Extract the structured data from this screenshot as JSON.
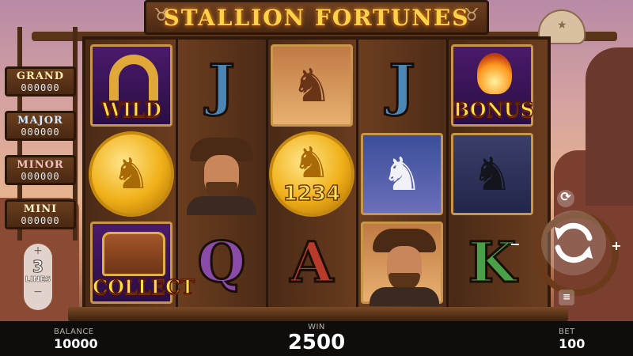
{
  "game": {
    "title": "STALLION FORTUNES"
  },
  "jackpots": [
    {
      "name": "GRAND",
      "value": "000000"
    },
    {
      "name": "MAJOR",
      "value": "000000"
    },
    {
      "name": "MINOR",
      "value": "000000"
    },
    {
      "name": "MINI",
      "value": "000000"
    }
  ],
  "lines": {
    "count": "3",
    "label": "LINES",
    "increase_icon": "plus-icon",
    "decrease_icon": "minus-icon"
  },
  "reels": [
    [
      {
        "symbol": "wild",
        "label": "WILD",
        "icon": "horseshoe-icon"
      },
      {
        "symbol": "gold-coin",
        "icon": "horse-coin-icon"
      },
      {
        "symbol": "collect",
        "label": "COLLECT",
        "icon": "treasure-chest-icon"
      }
    ],
    [
      {
        "symbol": "J",
        "label": "J"
      },
      {
        "symbol": "cowboy",
        "icon": "cowboy-icon"
      },
      {
        "symbol": "Q",
        "label": "Q"
      }
    ],
    [
      {
        "symbol": "brown-horse",
        "icon": "brown-horse-icon"
      },
      {
        "symbol": "gold-coin-value",
        "label": "1234",
        "icon": "horse-coin-icon"
      },
      {
        "symbol": "A",
        "label": "A"
      }
    ],
    [
      {
        "symbol": "J",
        "label": "J"
      },
      {
        "symbol": "white-horse",
        "icon": "white-horse-icon"
      },
      {
        "symbol": "cowboy",
        "icon": "cowboy-icon"
      }
    ],
    [
      {
        "symbol": "bonus",
        "label": "BONUS",
        "icon": "flaming-horseshoe-icon"
      },
      {
        "symbol": "black-horse",
        "icon": "black-horse-icon"
      },
      {
        "symbol": "K",
        "label": "K"
      }
    ]
  ],
  "controls": {
    "spin_icon": "spin-arrows-icon",
    "autoplay_icon": "autoplay-icon",
    "bet_minus": "−",
    "bet_plus": "+",
    "menu_icon": "menu-icon"
  },
  "status": {
    "balance_label": "BALANCE",
    "balance": "10000",
    "win_label": "WIN",
    "win": "2500",
    "bet_label": "BET",
    "bet": "100"
  },
  "colors": {
    "title": "#ffd24a",
    "symbol_label": "#ffe04a",
    "coin": "#f0b018"
  }
}
